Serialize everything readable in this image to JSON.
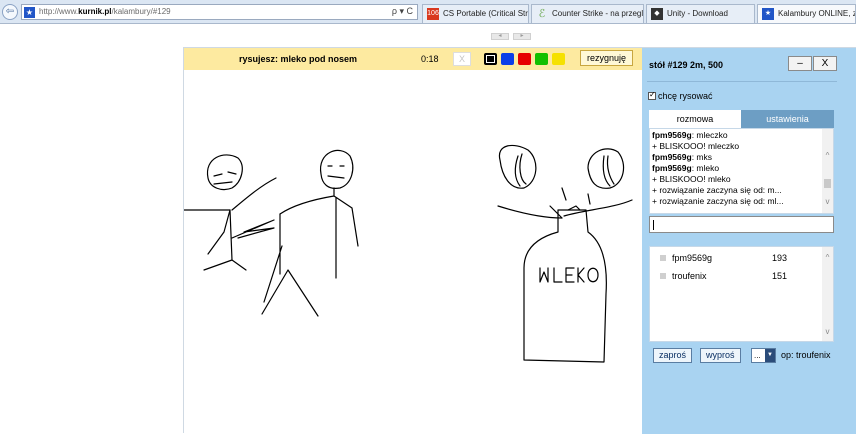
{
  "browser": {
    "url_prefix": "http://www.",
    "url_domain": "kurnik.pl",
    "url_path": "/kalambury/#129",
    "url_tools": "ρ ▾ C",
    "tabs": [
      {
        "label": "CS Portable (Critical Strike...",
        "icon": "game-favicon",
        "icon_text": "106",
        "icon_color": "#d9381e"
      },
      {
        "label": "Counter Strike - na przegl...",
        "icon": "cs-favicon",
        "icon_text": "",
        "icon_color": "#6aa84f"
      },
      {
        "label": "Unity - Download",
        "icon": "unity-favicon",
        "icon_text": "◆",
        "icon_color": "#333333"
      },
      {
        "label": "Kalambury ONLINE, zag...",
        "icon": "kurnik-favicon",
        "icon_text": "★",
        "icon_color": "#2256c7"
      }
    ]
  },
  "nudge": [
    "◂",
    "▸"
  ],
  "game": {
    "task": "rysujesz: mleko pod nosem",
    "timer": "0:18",
    "clear_label": "X",
    "colors": [
      "#000000",
      "#0b3ee8",
      "#e60000",
      "#13c000",
      "#f5e100"
    ],
    "selected_color": "#000000",
    "resign_label": "rezygnuję"
  },
  "side": {
    "table_title": "stół #129   2m, 500",
    "minimize_label": "–",
    "close_label": "X",
    "want_draw_label": "chcę rysować",
    "want_draw_checked": true,
    "tab_chat": "rozmowa",
    "tab_settings": "ustawienia",
    "chat": [
      {
        "user": "fpm9569g",
        "text": ": mleczko"
      },
      {
        "user": "",
        "text": "+ BLISKOOO! mleczko"
      },
      {
        "user": "fpm9569g",
        "text": ": mks"
      },
      {
        "user": "fpm9569g",
        "text": ": mleko"
      },
      {
        "user": "",
        "text": "+ BLISKOOO! mleko"
      },
      {
        "user": "",
        "text": "+ rozwiązanie zaczyna się od: m..."
      },
      {
        "user": "",
        "text": "+ rozwiązanie zaczyna się od: ml..."
      }
    ],
    "scroll_up": "^",
    "scroll_down": "v",
    "players": [
      {
        "name": "fpm9569g",
        "score": "193"
      },
      {
        "name": "troufenix",
        "score": "151"
      }
    ],
    "invite_label": "zaproś",
    "kick_label": "wyproś",
    "select_value": "...",
    "select_caret": "▼",
    "op_text": "op: troufenix"
  },
  "canvas_text": "MLEKO"
}
